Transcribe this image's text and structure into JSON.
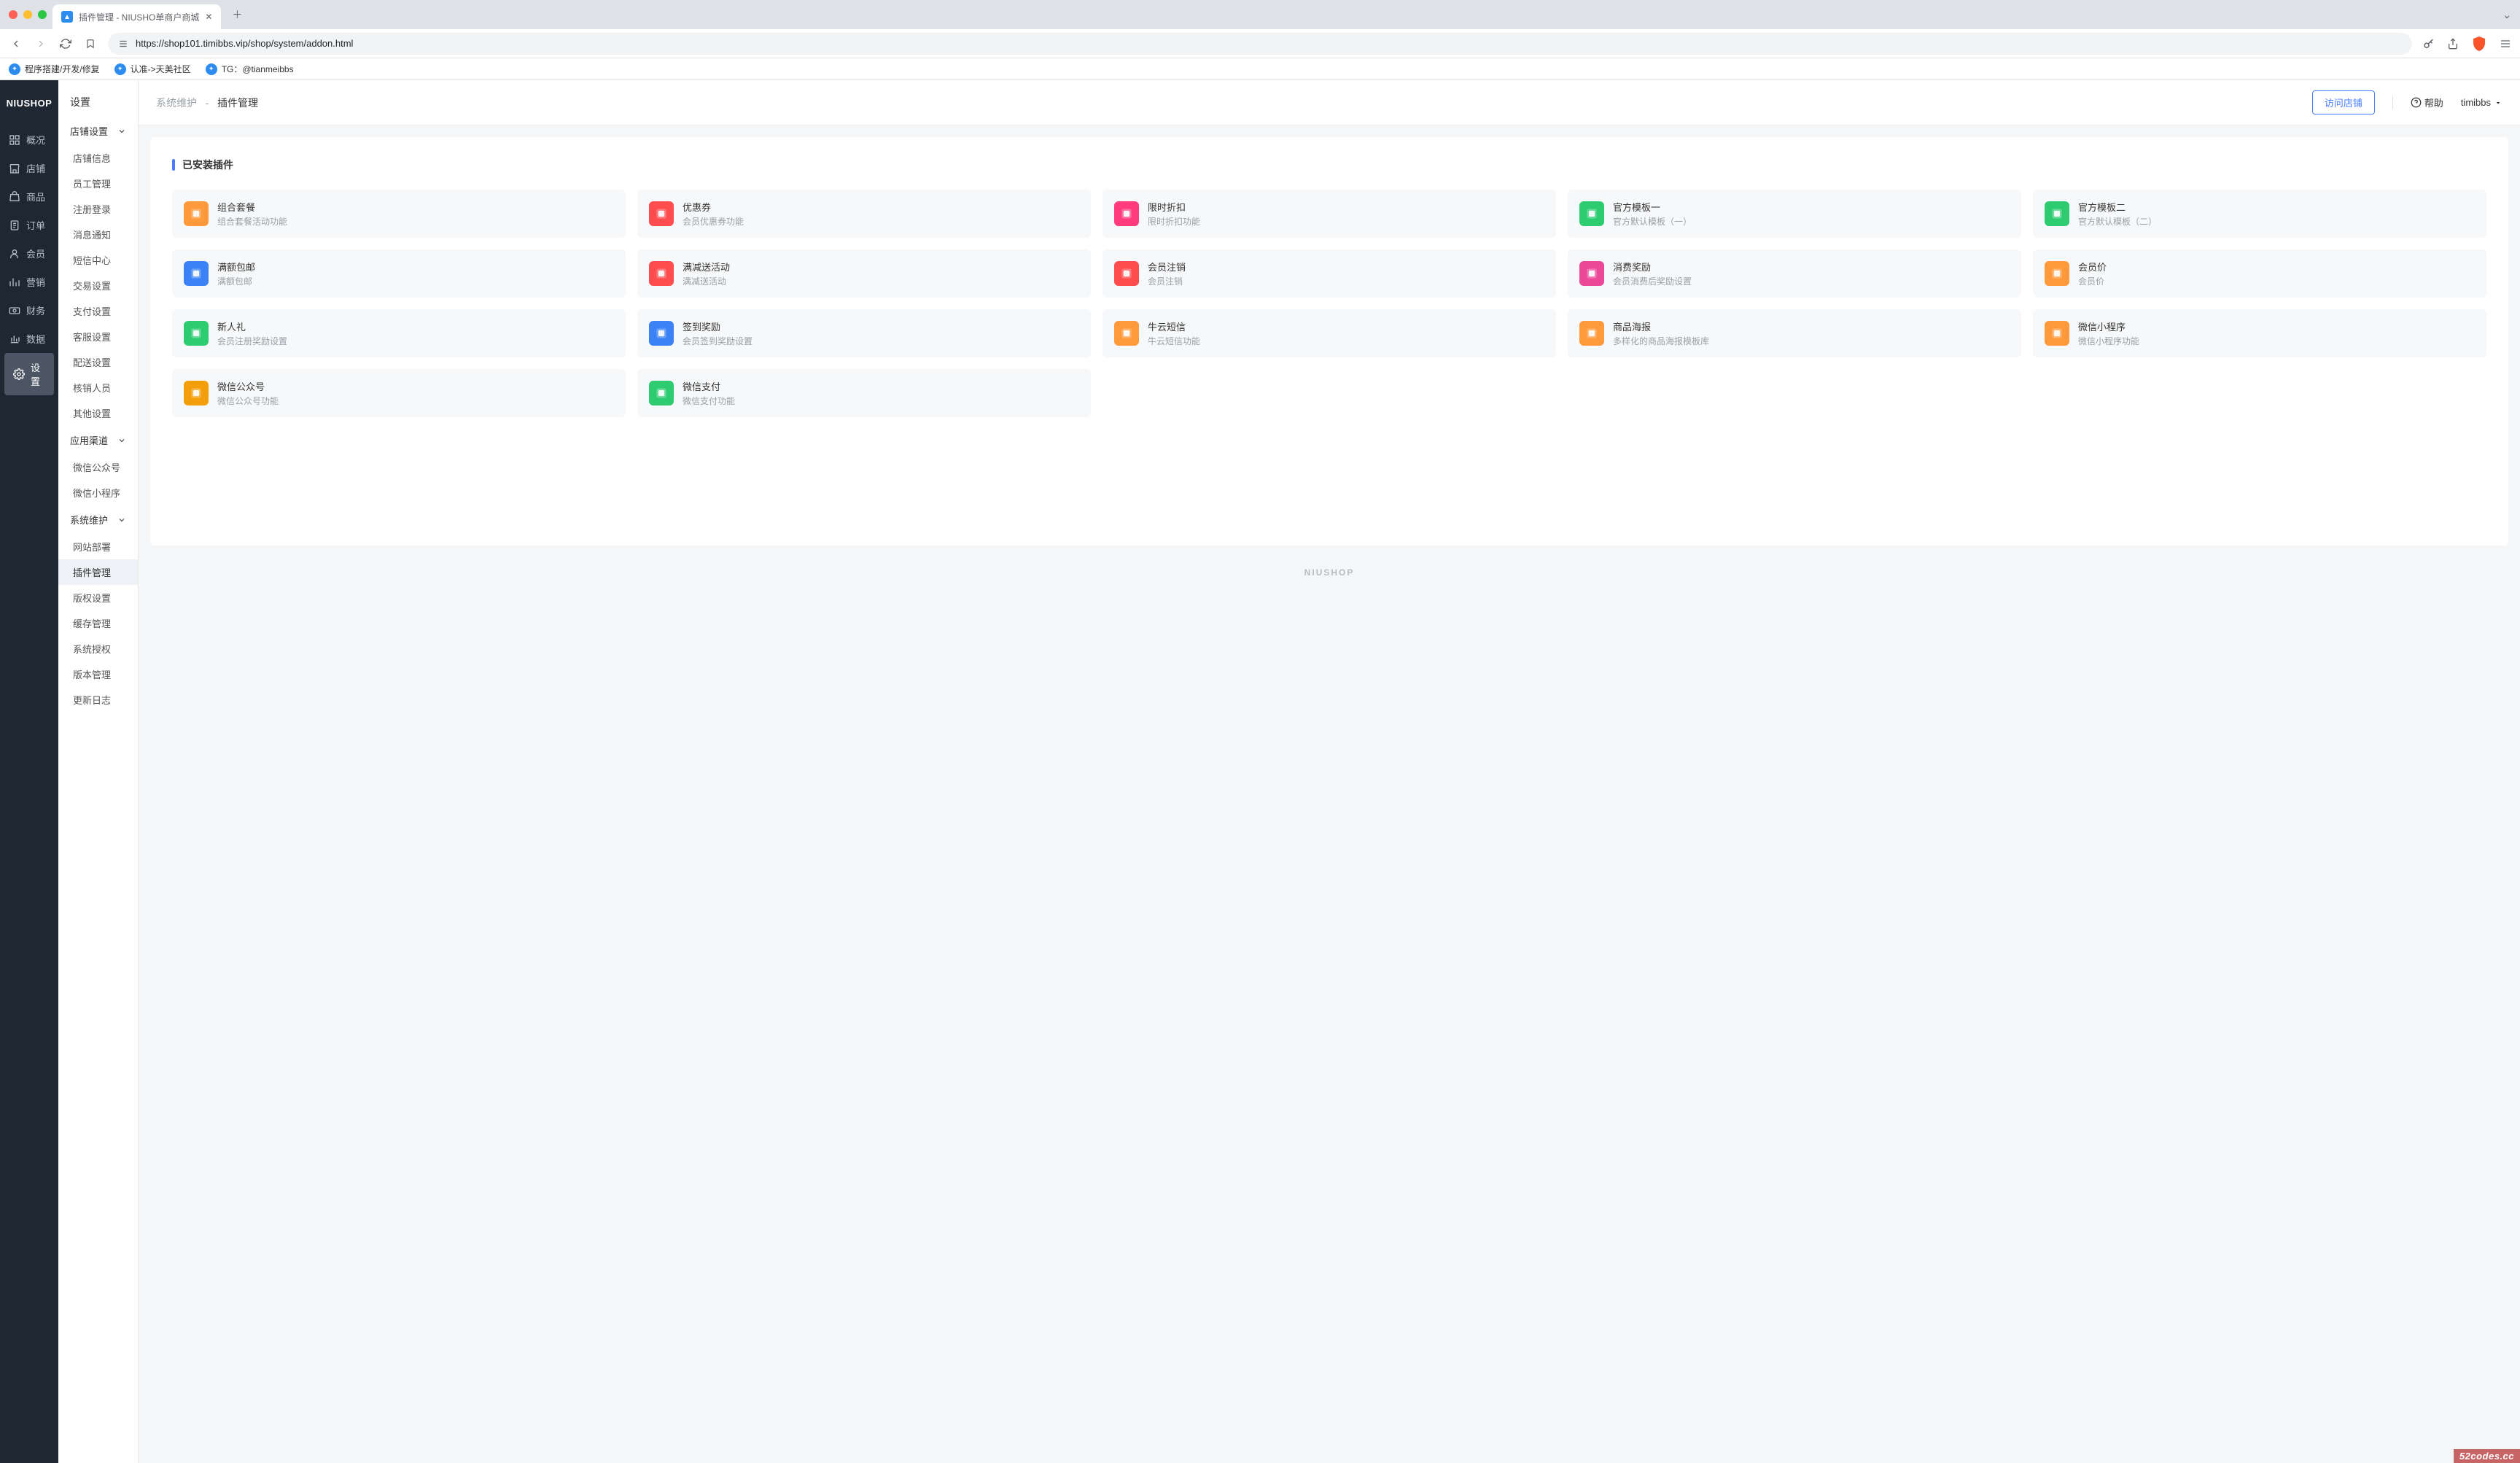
{
  "browser": {
    "tab_title": "插件管理 - NIUSHO单商户商城",
    "url": "https://shop101.timibbs.vip/shop/system/addon.html",
    "bookmarks": [
      "程序搭建/开发/修复",
      "认准->天美社区",
      "TG：@tianmeibbs"
    ]
  },
  "app": {
    "logo": "NIUSHOP",
    "main_nav": [
      {
        "label": "概况",
        "icon": "dashboard"
      },
      {
        "label": "店铺",
        "icon": "store"
      },
      {
        "label": "商品",
        "icon": "goods"
      },
      {
        "label": "订单",
        "icon": "order"
      },
      {
        "label": "会员",
        "icon": "member"
      },
      {
        "label": "营销",
        "icon": "marketing"
      },
      {
        "label": "财务",
        "icon": "finance"
      },
      {
        "label": "数据",
        "icon": "data"
      },
      {
        "label": "设置",
        "icon": "settings",
        "active": true
      }
    ],
    "sub_title": "设置",
    "sub_groups": [
      {
        "head": "店铺设置",
        "items": [
          "店铺信息",
          "员工管理",
          "注册登录",
          "消息通知",
          "短信中心",
          "交易设置",
          "支付设置",
          "客服设置",
          "配送设置",
          "核销人员",
          "其他设置"
        ]
      },
      {
        "head": "应用渠道",
        "items": [
          "微信公众号",
          "微信小程序"
        ]
      },
      {
        "head": "系统维护",
        "items": [
          "网站部署",
          "插件管理",
          "版权设置",
          "缓存管理",
          "系统授权",
          "版本管理",
          "更新日志"
        ],
        "active_item": "插件管理"
      }
    ],
    "breadcrumb": {
      "a": "系统维护",
      "sep": "-",
      "b": "插件管理"
    },
    "topbar": {
      "visit": "访问店铺",
      "help": "帮助",
      "user": "timibbs"
    },
    "section_title": "已安装插件",
    "plugins": [
      {
        "title": "组合套餐",
        "desc": "组合套餐活动功能",
        "color": "#ff9a3c"
      },
      {
        "title": "优惠券",
        "desc": "会员优惠券功能",
        "color": "#ff4d4f"
      },
      {
        "title": "限时折扣",
        "desc": "限时折扣功能",
        "color": "#ff3b7d"
      },
      {
        "title": "官方模板一",
        "desc": "官方默认模板（一）",
        "color": "#2ecc71"
      },
      {
        "title": "官方模板二",
        "desc": "官方默认模板（二）",
        "color": "#2ecc71"
      },
      {
        "title": "满额包邮",
        "desc": "满额包邮",
        "color": "#3b82f6"
      },
      {
        "title": "满减送活动",
        "desc": "满减送活动",
        "color": "#ff4d4f"
      },
      {
        "title": "会员注销",
        "desc": "会员注销",
        "color": "#ff4d4f"
      },
      {
        "title": "消费奖励",
        "desc": "会员消费后奖励设置",
        "color": "#ec4899"
      },
      {
        "title": "会员价",
        "desc": "会员价",
        "color": "#ff9a3c"
      },
      {
        "title": "新人礼",
        "desc": "会员注册奖励设置",
        "color": "#2ecc71"
      },
      {
        "title": "签到奖励",
        "desc": "会员签到奖励设置",
        "color": "#3b82f6"
      },
      {
        "title": "牛云短信",
        "desc": "牛云短信功能",
        "color": "#ff9a3c"
      },
      {
        "title": "商品海报",
        "desc": "多样化的商品海报模板库",
        "color": "#ff9a3c"
      },
      {
        "title": "微信小程序",
        "desc": "微信小程序功能",
        "color": "#ff9a3c"
      },
      {
        "title": "微信公众号",
        "desc": "微信公众号功能",
        "color": "#f59e0b"
      },
      {
        "title": "微信支付",
        "desc": "微信支付功能",
        "color": "#2ecc71"
      }
    ],
    "footer_brand": "NIUSHOP"
  },
  "watermark": "52codes.cc"
}
